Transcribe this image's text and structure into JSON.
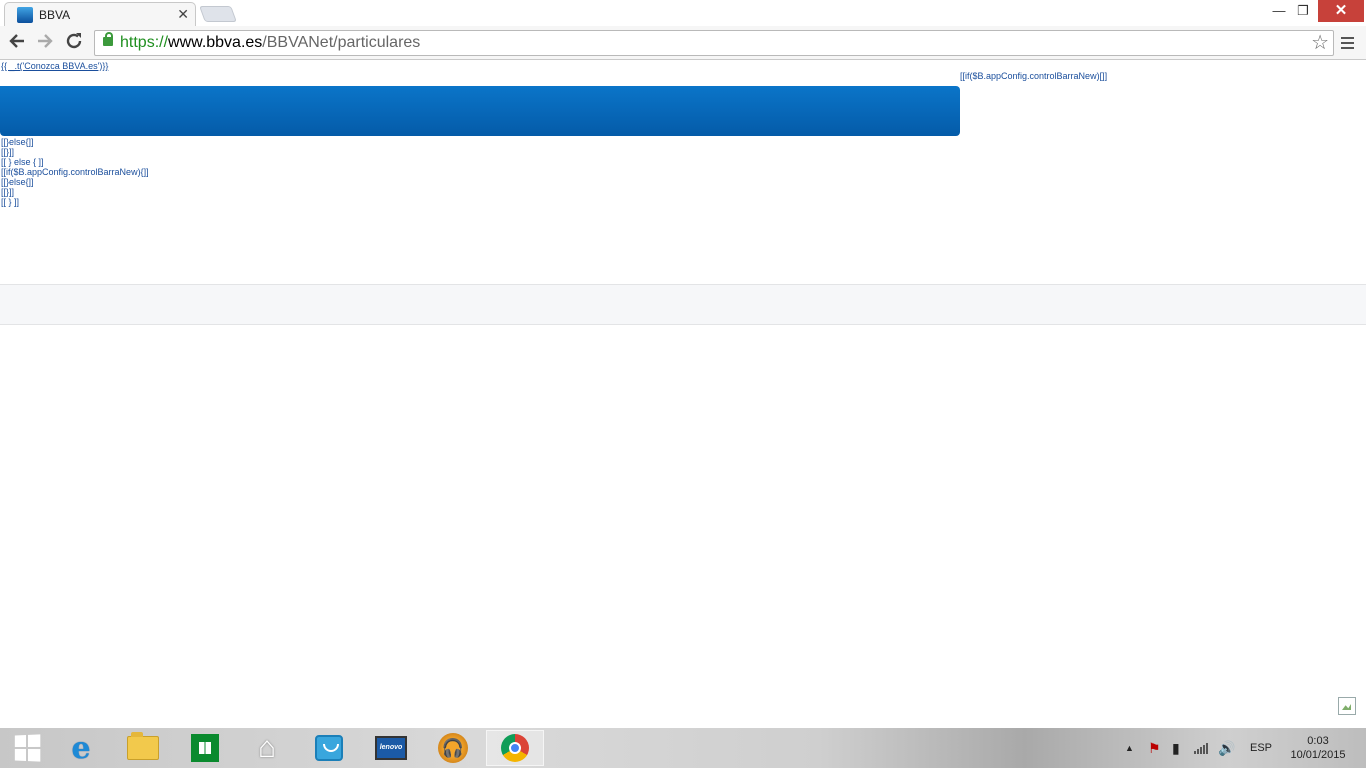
{
  "browser": {
    "tab": {
      "title": "BBVA",
      "close_glyph": "✕"
    },
    "window_controls": {
      "minimize": "—",
      "maximize": "❐",
      "close": "✕"
    },
    "address": {
      "scheme": "https://",
      "host": "www.bbva.es",
      "path": "/BBVANet/particulares"
    },
    "icons": [
      "back-arrow-icon",
      "forward-arrow-icon",
      "reload-icon",
      "lock-icon",
      "bookmark-star-icon",
      "menu-icon"
    ]
  },
  "page": {
    "top_link": "{{ _.t('Conozca BBVA.es')}}",
    "right_template": "[[if($B.appConfig.controlBarraNew)[]]",
    "template_lines": [
      "[[}else{]]",
      "[[}]]",
      "[[ } else { ]]",
      "[[if($B.appConfig.controlBarraNew){]]",
      "[[}else{]]",
      "[[}]]",
      "[[ } ]]"
    ],
    "colors": {
      "bar_top": "#0b75c9",
      "bar_bottom": "#045ba8",
      "link": "#1a4e9c"
    }
  },
  "taskbar": {
    "apps": [
      "start-button",
      "internet-explorer",
      "file-explorer",
      "windows-store",
      "home",
      "shopping-bag",
      "lenovo-monitor",
      "music-player",
      "chrome"
    ],
    "monitor_label": "lenovo",
    "tray": {
      "language": "ESP",
      "time": "0:03",
      "date": "10/01/2015"
    }
  }
}
